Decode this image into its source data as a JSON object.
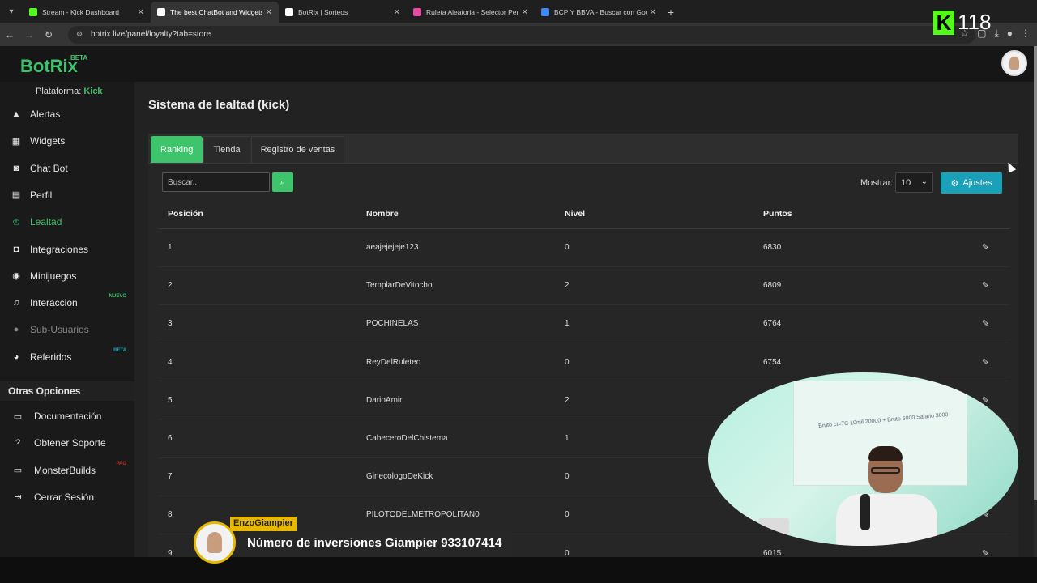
{
  "browser": {
    "tabs": [
      {
        "title": "Stream - Kick Dashboard",
        "fav": "#53fc18",
        "active": false
      },
      {
        "title": "The best ChatBot and Widgets",
        "fav": "#ffffff",
        "active": true
      },
      {
        "title": "BotRix | Sorteos",
        "fav": "#ffffff",
        "active": false
      },
      {
        "title": "Ruleta Aleatoria - Selector Perso",
        "fav": "#e94ba3",
        "active": false
      },
      {
        "title": "BCP Y BBVA - Buscar con Goog",
        "fav": "#4285f4",
        "active": false
      }
    ],
    "url": "botrix.live/panel/loyalty?tab=store"
  },
  "overlay": {
    "kick_counter": "118",
    "kick_letter": "K",
    "chat_user": "EnzoGiampier",
    "chat_message": "Número de inversiones Giampier 933107414",
    "board_text": "Bruto ct=7C  10mil  20000 + Bruto 5000  Salario 3000"
  },
  "app": {
    "logo": "BotRix",
    "logo_badge": "BETA",
    "platform_label": "Plataforma:",
    "platform_value": "Kick"
  },
  "sidebar": {
    "items": [
      {
        "label": "Alertas",
        "icon": "warning-icon",
        "glyph": "▲"
      },
      {
        "label": "Widgets",
        "icon": "grid-icon",
        "glyph": "▦"
      },
      {
        "label": "Chat Bot",
        "icon": "robot-icon",
        "glyph": "◙"
      },
      {
        "label": "Perfil",
        "icon": "id-card-icon",
        "glyph": "▤"
      },
      {
        "label": "Lealtad",
        "icon": "trophy-icon",
        "glyph": "♔"
      },
      {
        "label": "Integraciones",
        "icon": "plug-icon",
        "glyph": "◘"
      },
      {
        "label": "Minijuegos",
        "icon": "gamepad-icon",
        "glyph": "◉"
      },
      {
        "label": "Interacción",
        "icon": "music-icon",
        "glyph": "♫",
        "badge": "NUEVO",
        "badge_color": "#3ec46d"
      },
      {
        "label": "Sub-Usuarios",
        "icon": "users-icon",
        "glyph": "●"
      },
      {
        "label": "Referidos",
        "icon": "users-group-icon",
        "glyph": "◕",
        "badge": "BETA",
        "badge_color": "#1aa0b8"
      }
    ],
    "section_title": "Otras Opciones",
    "other": [
      {
        "label": "Documentación",
        "icon": "book-icon",
        "glyph": "▭"
      },
      {
        "label": "Obtener Soporte",
        "icon": "question-icon",
        "glyph": "?"
      },
      {
        "label": "MonsterBuilds",
        "icon": "monitor-icon",
        "glyph": "▭",
        "badge": "PAG",
        "badge_color": "#c0392b"
      },
      {
        "label": "Cerrar Sesión",
        "icon": "logout-icon",
        "glyph": "⇥"
      }
    ]
  },
  "main": {
    "title": "Sistema de lealtad (kick)",
    "tabs": [
      "Ranking",
      "Tienda",
      "Registro de ventas"
    ],
    "search_placeholder": "Buscar...",
    "show_label": "Mostrar:",
    "show_value": "10",
    "ajustes_label": "Ajustes",
    "columns": [
      "Posición",
      "Nombre",
      "Nivel",
      "Puntos"
    ],
    "rows": [
      {
        "pos": "1",
        "name": "aeajejejeje123",
        "level": "0",
        "points": "6830"
      },
      {
        "pos": "2",
        "name": "TemplarDeVitocho",
        "level": "2",
        "points": "6809"
      },
      {
        "pos": "3",
        "name": "POCHINELAS",
        "level": "1",
        "points": "6764"
      },
      {
        "pos": "4",
        "name": "ReyDelRuleteo",
        "level": "0",
        "points": "6754"
      },
      {
        "pos": "5",
        "name": "DarioAmir",
        "level": "2",
        "points": ""
      },
      {
        "pos": "6",
        "name": "CabeceroDelChistema",
        "level": "1",
        "points": ""
      },
      {
        "pos": "7",
        "name": "GinecologoDeKick",
        "level": "0",
        "points": ""
      },
      {
        "pos": "8",
        "name": "PILOTODELMETROPOLITAN0",
        "level": "0",
        "points": ""
      },
      {
        "pos": "9",
        "name": "",
        "level": "0",
        "points": "6015"
      }
    ]
  }
}
